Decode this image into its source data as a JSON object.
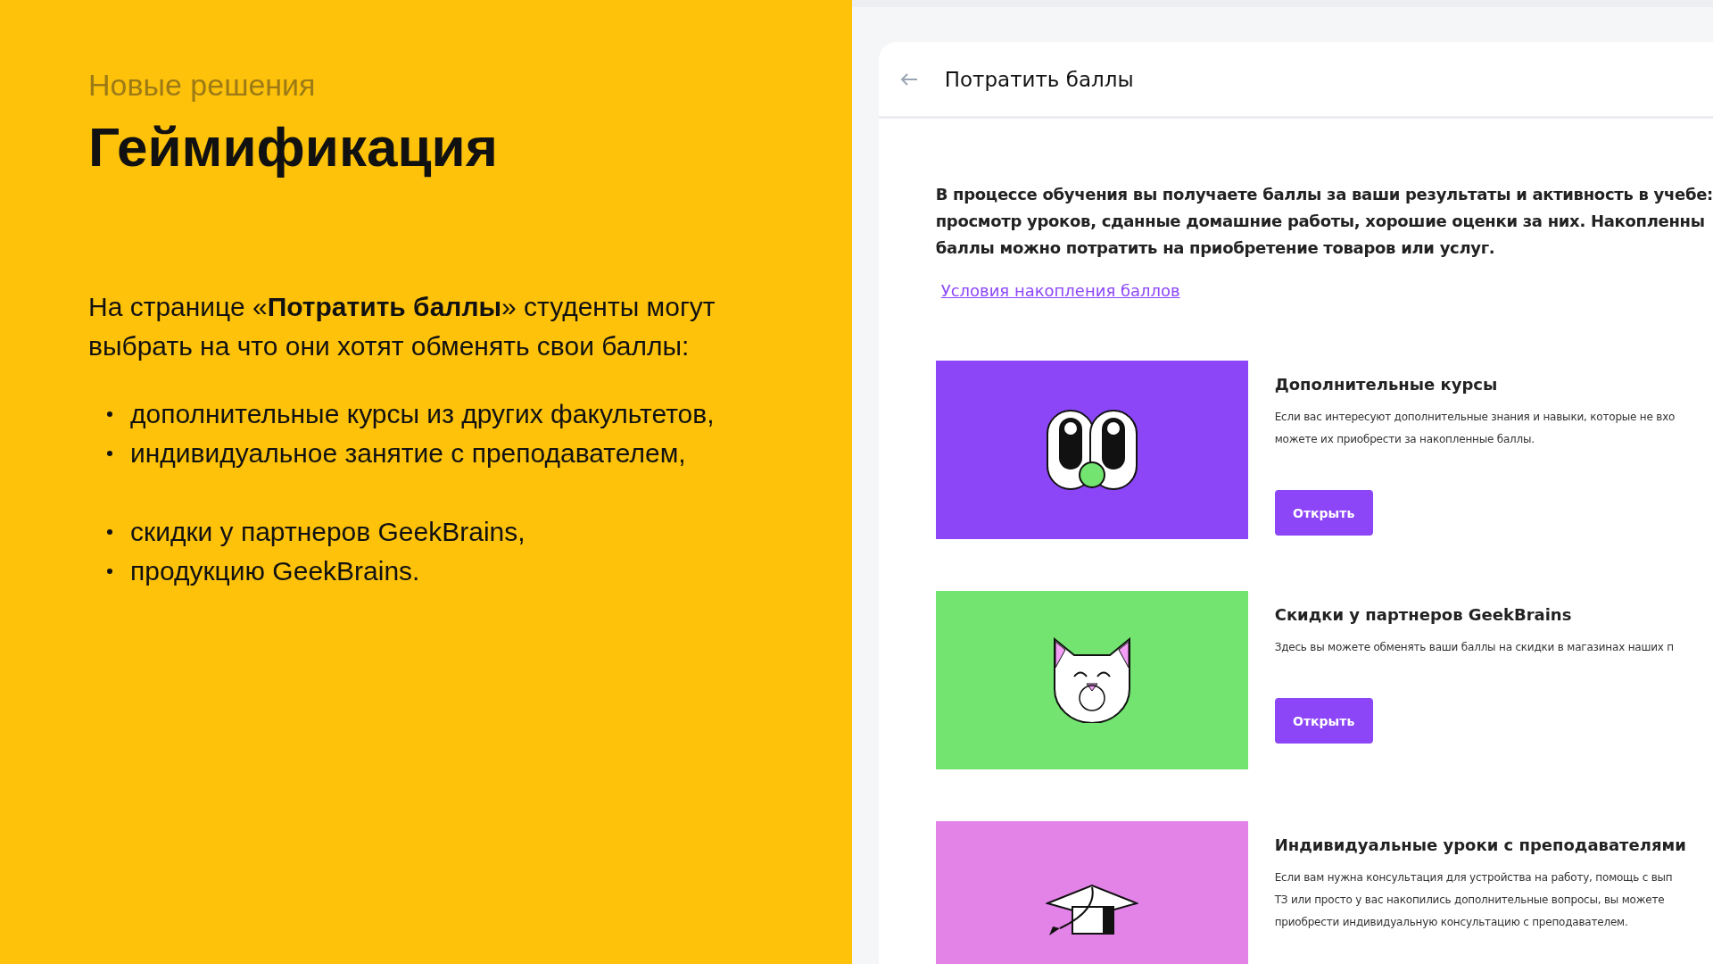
{
  "slide": {
    "subtitle": "Новые решения",
    "title": "Геймификация",
    "intro": "На странице «**Потратить баллы**» студенты могут выбрать на что они хотят обменять свои баллы:",
    "bullet_groups": [
      [
        "дополнительные курсы из других факультетов,",
        "индивидуальное занятие с преподавателем,"
      ],
      [
        "скидки у партнеров GeekBrains,",
        "продукцию GeekBrains."
      ]
    ]
  },
  "page": {
    "title": "Потратить баллы",
    "intro_lines": [
      "В процессе обучения вы получаете баллы за ваши результаты и активность в учебе:",
      "просмотр уроков, сданные домашние работы, хорошие оценки за них.  Накопленны",
      "баллы можно потратить на приобретение товаров или услуг."
    ],
    "link": "Условия накопления баллов",
    "cards": [
      {
        "kind": "eyes",
        "color": "#8c46f7",
        "title": "Дополнительные курсы",
        "lines": [
          "Если вас интересуют дополнительные знания и навыки, которые не вхо",
          "можете их приобрести за накопленные баллы."
        ],
        "button": "Открыть"
      },
      {
        "kind": "cat",
        "color": "#72e46f",
        "title": "Скидки у партнеров GeekBrains",
        "lines": [
          "Здесь вы можете обменять ваши баллы на скидки в магазинах наших п"
        ],
        "button": "Открыть"
      },
      {
        "kind": "cap",
        "color": "#e383e8",
        "title": "Индивидуальные уроки с преподавателями",
        "lines": [
          "Если вам нужна консультация для устройства на работу, помощь с вып",
          "ТЗ или просто у вас накопились дополнительные вопросы, вы можете",
          "приобрести индивидуальную консультацию с преподавателем."
        ]
      }
    ]
  }
}
